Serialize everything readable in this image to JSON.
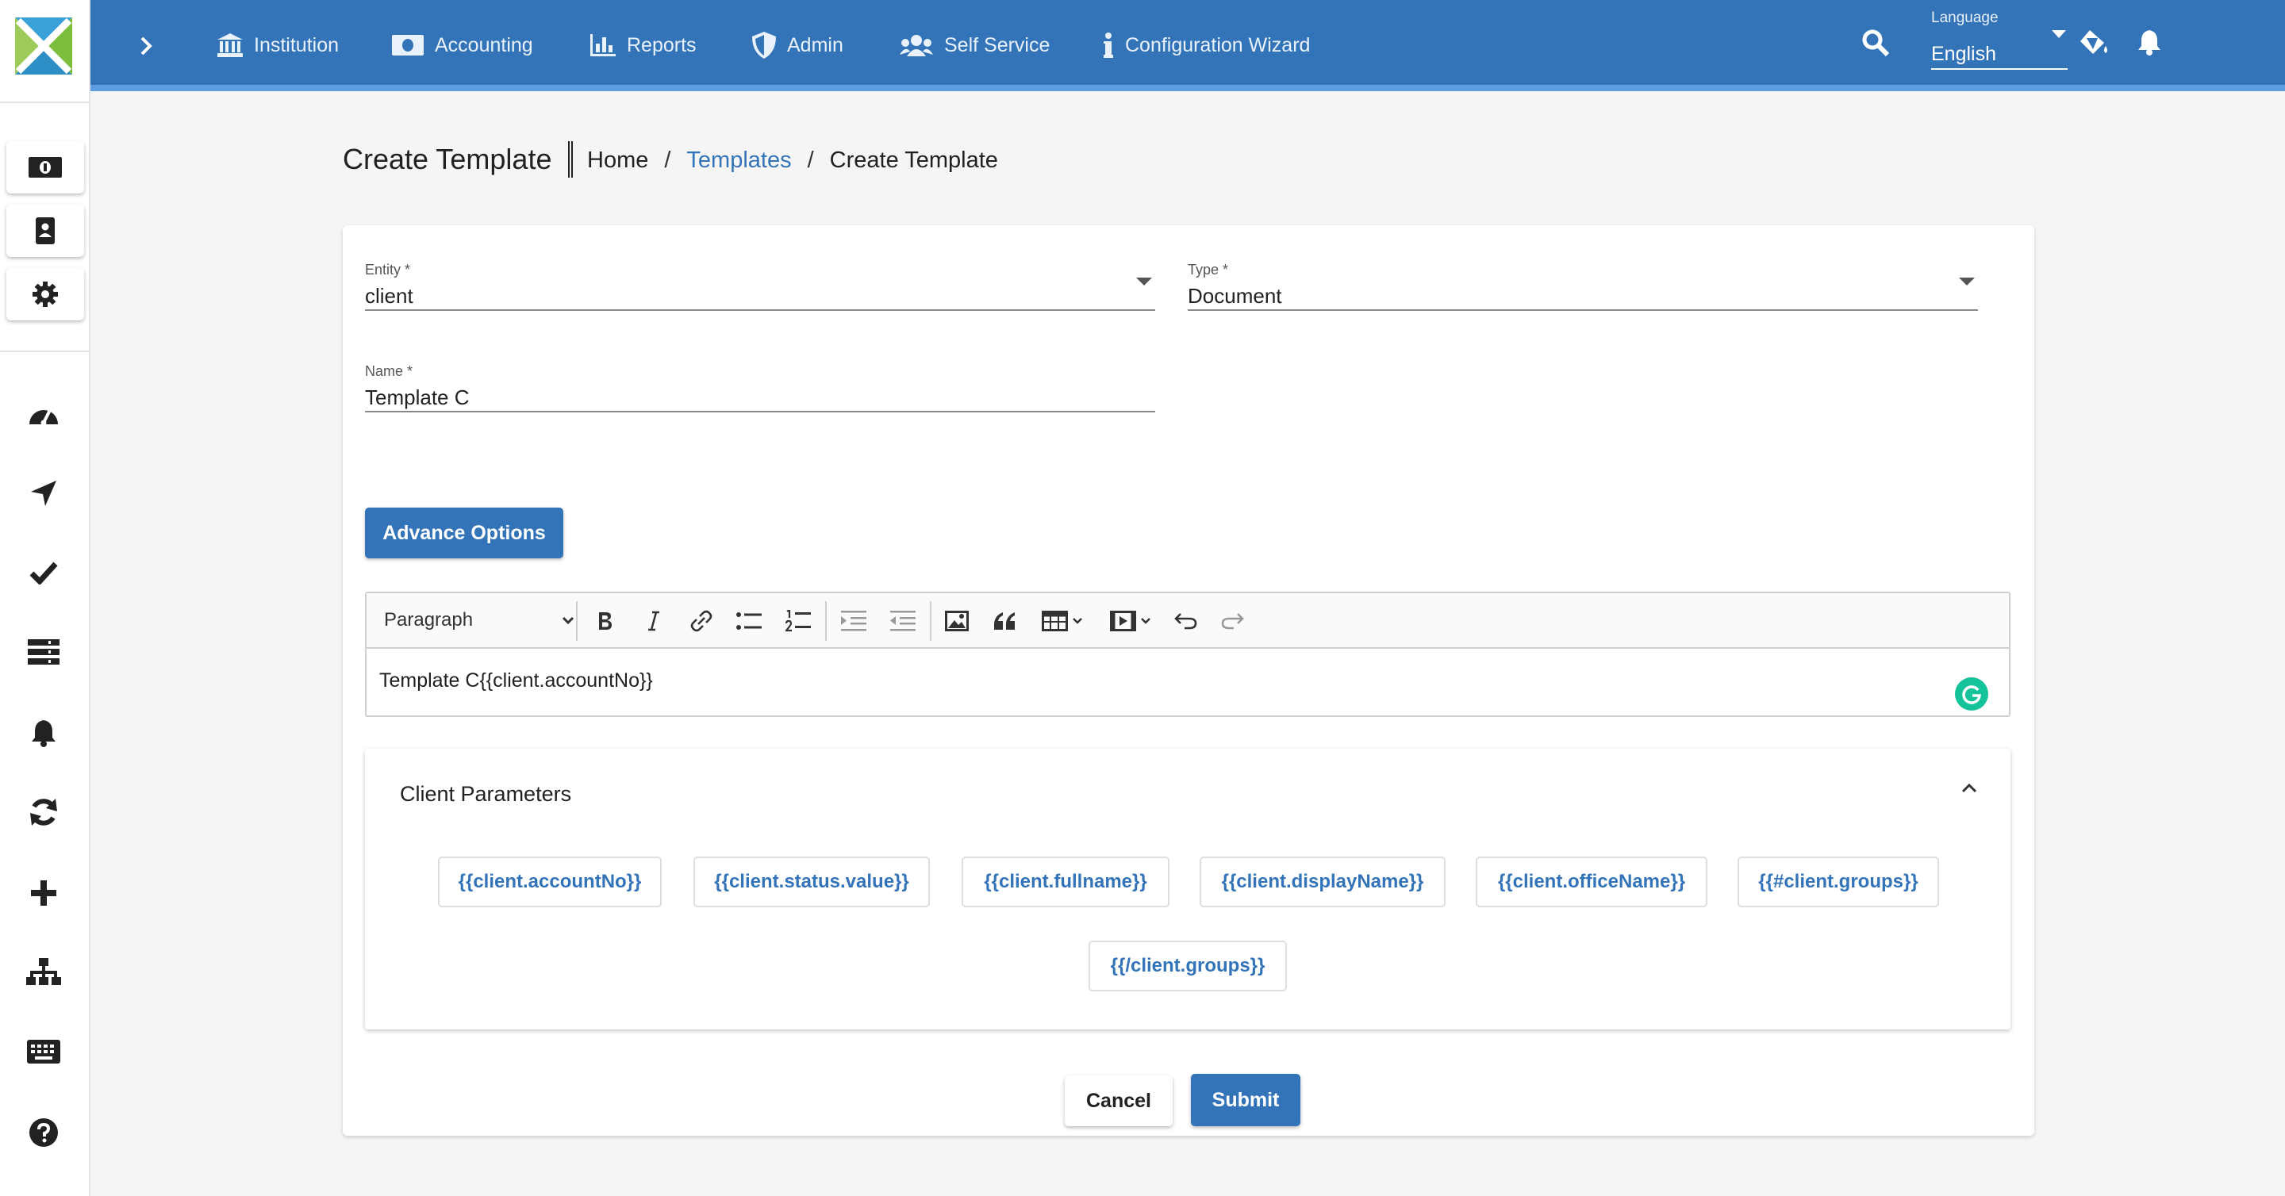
{
  "nav": {
    "items": [
      {
        "label": "Institution",
        "icon": "institution-icon"
      },
      {
        "label": "Accounting",
        "icon": "money-icon"
      },
      {
        "label": "Reports",
        "icon": "bar-chart-icon"
      },
      {
        "label": "Admin",
        "icon": "shield-icon"
      },
      {
        "label": "Self Service",
        "icon": "users-icon"
      },
      {
        "label": "Configuration Wizard",
        "icon": "info-icon"
      }
    ],
    "language_label": "Language",
    "language_value": "English"
  },
  "rail": {
    "cards": [
      "money-icon",
      "contact-book-icon",
      "gear-icon"
    ],
    "icons": [
      "dashboard-icon",
      "navigate-icon",
      "check-icon",
      "list-icon",
      "bell-icon",
      "sync-icon",
      "plus-icon",
      "sitemap-icon",
      "keyboard-icon",
      "help-icon"
    ]
  },
  "header": {
    "title": "Create Template",
    "breadcrumb": [
      "Home",
      "Templates",
      "Create Template"
    ],
    "separator": "/"
  },
  "form": {
    "entity": {
      "label": "Entity *",
      "value": "client"
    },
    "type": {
      "label": "Type *",
      "value": "Document"
    },
    "name": {
      "label": "Name *",
      "value": "Template C"
    },
    "advance_options": "Advance Options"
  },
  "editor": {
    "block_format": "Paragraph",
    "content": "Template C{{client.accountNo}}"
  },
  "parameters": {
    "title": "Client Parameters",
    "chips": [
      "{{client.accountNo}}",
      "{{client.status.value}}",
      "{{client.fullname}}",
      "{{client.displayName}}",
      "{{client.officeName}}",
      "{{#client.groups}}",
      "{{/client.groups}}"
    ]
  },
  "actions": {
    "cancel": "Cancel",
    "submit": "Submit"
  },
  "colors": {
    "primary": "#3374b9",
    "topbar_accent": "#5d9de0",
    "grammarly": "#15c39a",
    "background": "#f5f5f5"
  }
}
